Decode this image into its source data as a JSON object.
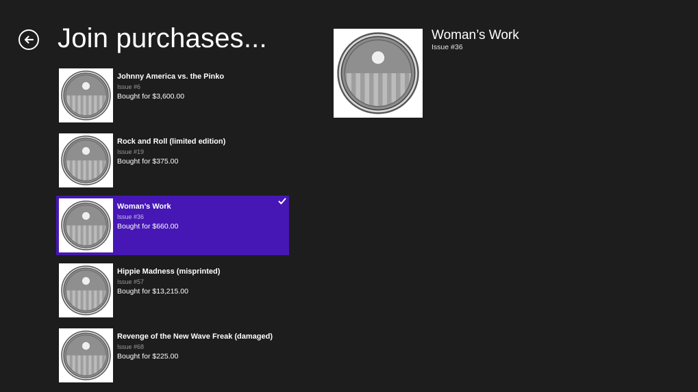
{
  "header": {
    "title": "Join purchases...",
    "back_icon": "back-arrow-icon"
  },
  "colors": {
    "background": "#1d1d1d",
    "accent": "#4617b4",
    "issue_text": "#9a9a9a"
  },
  "items": [
    {
      "title": "Johnny America vs. the Pinko",
      "issue": "Issue #6",
      "price": "Bought for $3,600.00",
      "selected": false
    },
    {
      "title": "Rock and Roll (limited edition)",
      "issue": "Issue #19",
      "price": "Bought for $375.00",
      "selected": false
    },
    {
      "title": "Woman’s Work",
      "issue": "Issue #36",
      "price": "Bought for $660.00",
      "selected": true
    },
    {
      "title": "Hippie Madness (misprinted)",
      "issue": "Issue #57",
      "price": "Bought for $13,215.00",
      "selected": false
    },
    {
      "title": "Revenge of the New Wave Freak (damaged)",
      "issue": "Issue #68",
      "price": "Bought for $225.00",
      "selected": false
    }
  ],
  "detail": {
    "title": "Woman’s Work",
    "issue": "Issue #36",
    "image_icon": "shield-cover-icon"
  }
}
